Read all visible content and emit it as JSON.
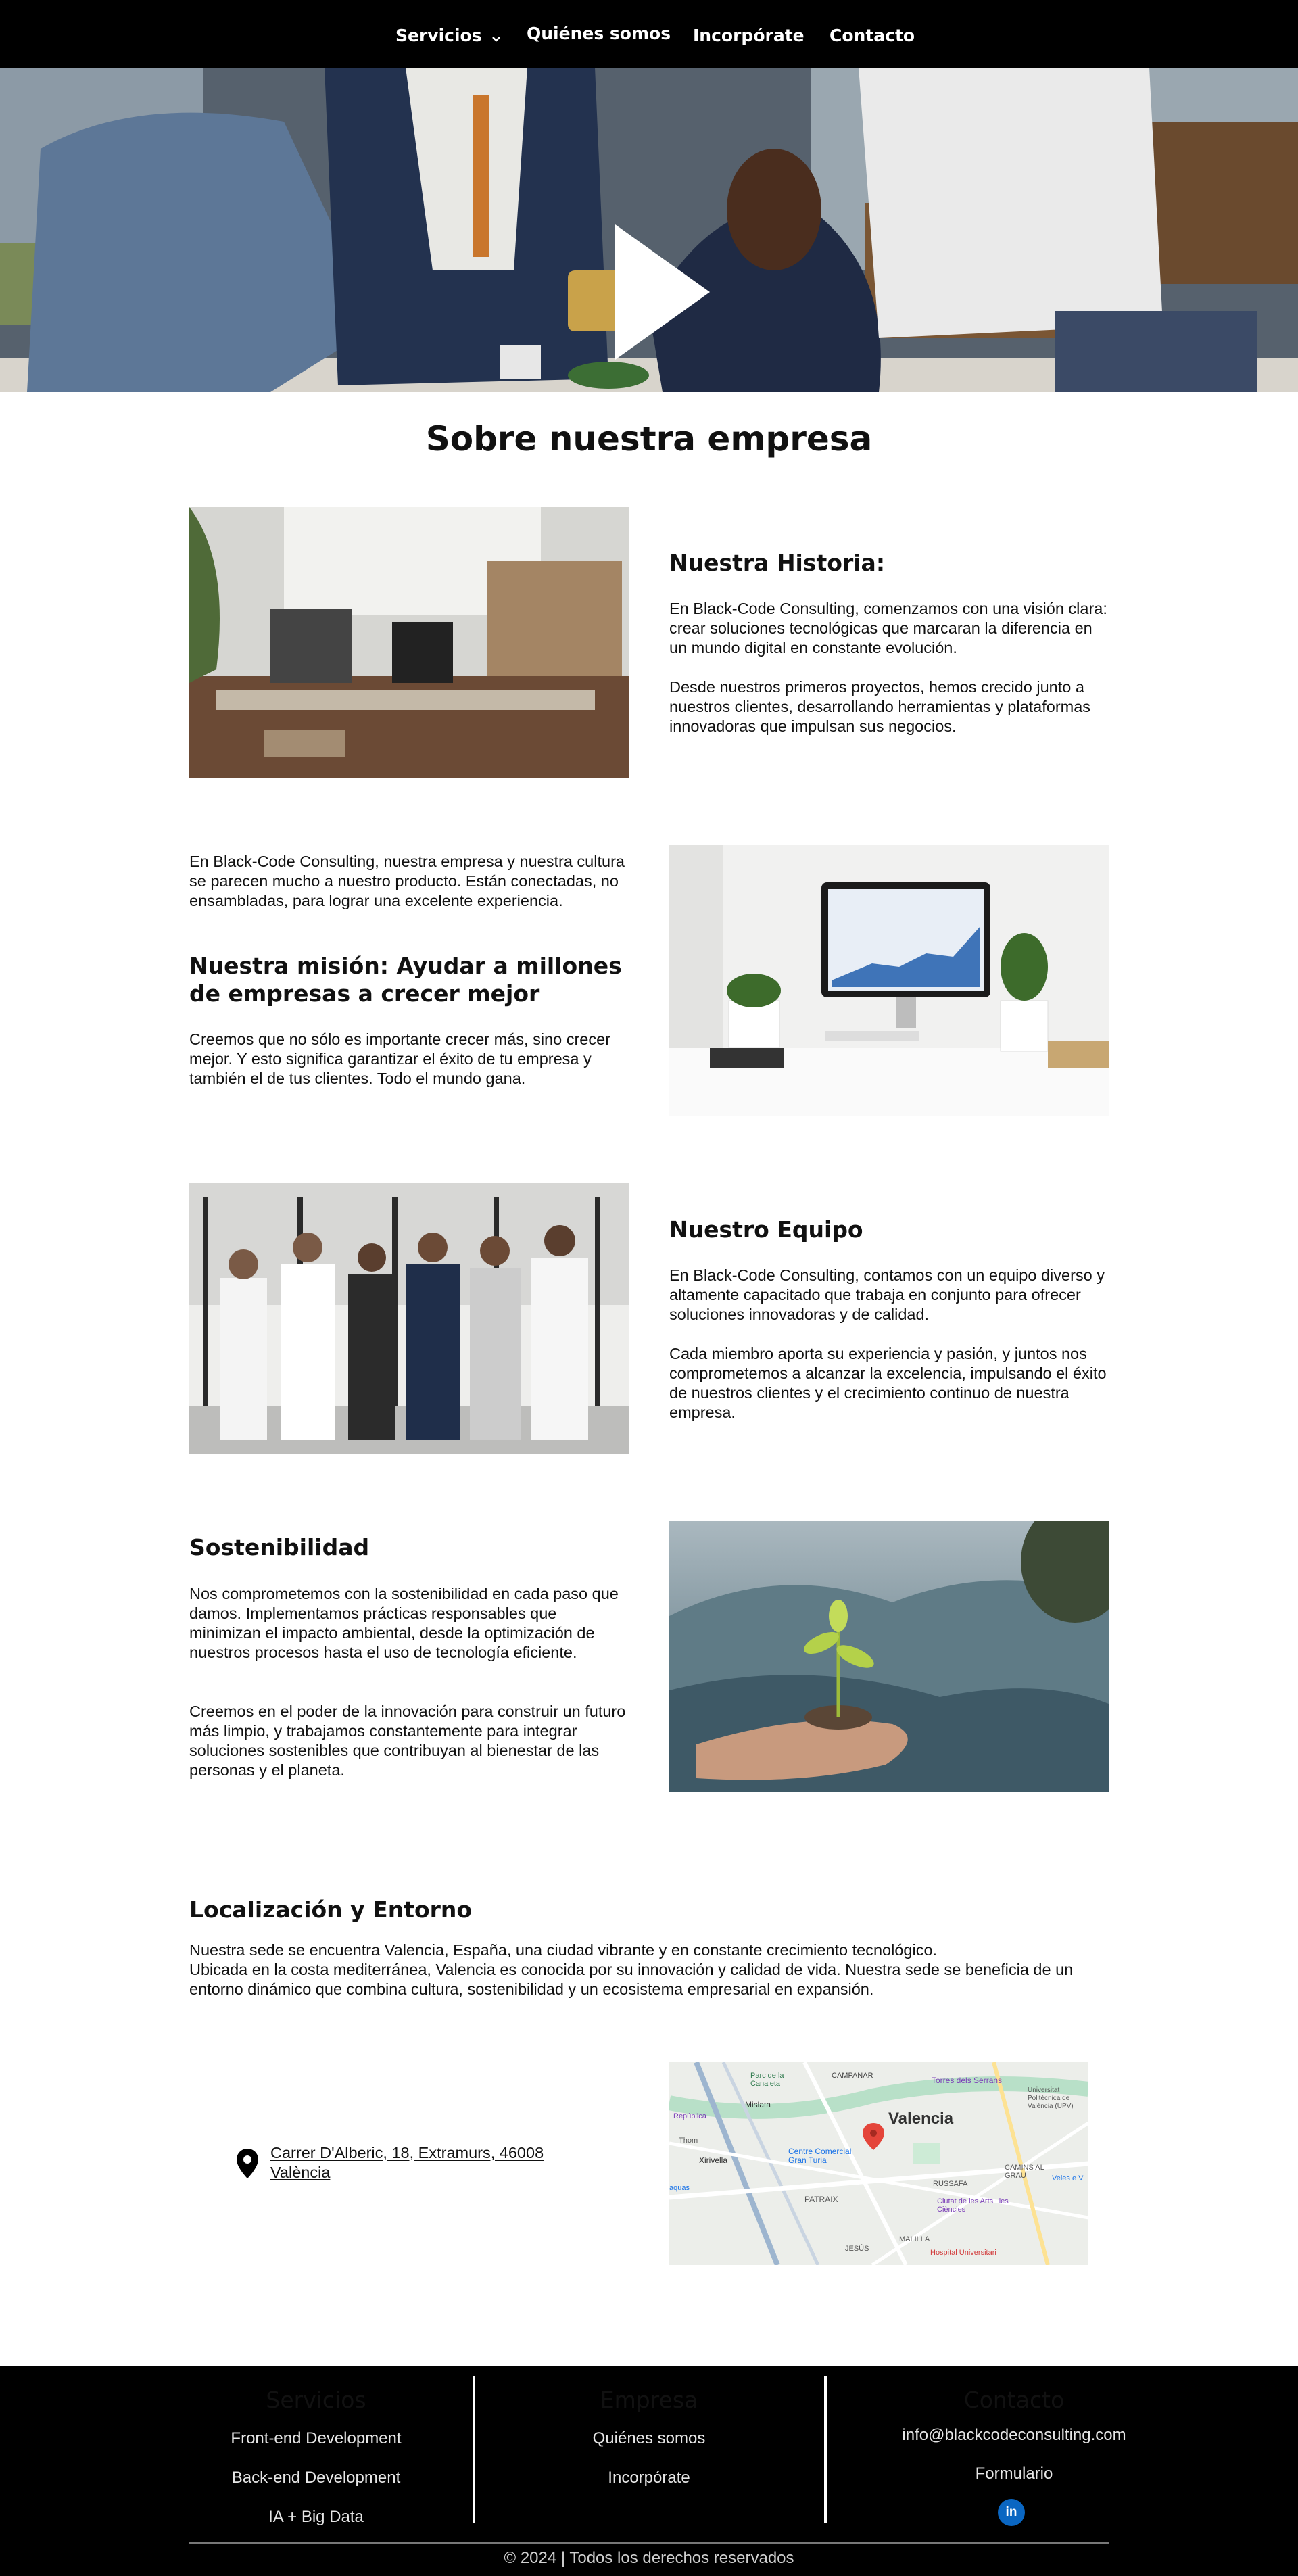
{
  "nav": {
    "items": [
      "Servicios",
      "Quiénes somos",
      "Incorpórate",
      "Contacto"
    ]
  },
  "hero": {
    "play_icon": "play-icon"
  },
  "page_title": "Sobre nuestra empresa",
  "history": {
    "title": "Nuestra Historia:",
    "p1": "En Black-Code Consulting, comenzamos con una visión clara: crear soluciones tecnológicas que marcaran la diferencia en un mundo digital en constante evolución.",
    "p2": "Desde nuestros primeros proyectos, hemos crecido junto a nuestros clientes, desarrollando herramientas y plataformas innovadoras que impulsan sus negocios."
  },
  "mission": {
    "intro": "En Black-Code Consulting, nuestra empresa y nuestra cultura se parecen mucho a nuestro producto. Están conectadas, no ensambladas, para lograr una excelente experiencia.",
    "title": "Nuestra misión: Ayudar a millones de empresas a crecer mejor",
    "p": "Creemos que no sólo es importante crecer más, sino crecer mejor. Y esto significa garantizar el éxito de tu empresa y también el de tus clientes. Todo el mundo gana."
  },
  "team": {
    "title": "Nuestro Equipo",
    "p1": "En Black-Code Consulting, contamos con un equipo diverso y altamente capacitado que trabaja en conjunto para ofrecer soluciones innovadoras y de calidad.",
    "p2": "Cada miembro aporta su experiencia y pasión, y juntos nos comprometemos a alcanzar la excelencia, impulsando el éxito de nuestros clientes y el crecimiento continuo de nuestra empresa."
  },
  "sustainability": {
    "title": "Sostenibilidad",
    "p1": "Nos comprometemos con la sostenibilidad en cada paso que damos. Implementamos prácticas responsables que minimizan el impacto ambiental, desde la optimización de nuestros procesos hasta el uso de tecnología eficiente.",
    "p2": "Creemos en el poder de la innovación para construir un futuro más limpio, y trabajamos constantemente para integrar soluciones sostenibles que contribuyan al bienestar de las personas y el planeta."
  },
  "location": {
    "title": "Localización y Entorno",
    "line1": "Nuestra sede  se encuentra Valencia, España, una ciudad vibrante y en constante crecimiento tecnológico.",
    "line2": "Ubicada en la costa mediterránea, Valencia es conocida por su innovación y calidad de vida. Nuestra sede se beneficia de un entorno dinámico que combina cultura, sostenibilidad y un ecosistema empresarial en expansión.",
    "address_line1": "Carrer D'Alberic, 18, Extramurs, 46008",
    "address_line2": "València",
    "map": {
      "city": "Valencia",
      "labels": [
        "Parc de la Canaleta",
        "Mislata",
        "Torres dels Serrans",
        "CAMPANAR",
        "Universitat Politècnica de València (UPV)",
        "Centre Comercial Gran Turia",
        "Xirivella",
        "PATRAIX",
        "RUSSAFA",
        "CAMINS AL GRAU",
        "Ciutat de les Arts i les Ciències",
        "MALILLA",
        "JESÚS",
        "Hospital Universitari",
        "República",
        "Thom",
        "aquas",
        "Veles e V"
      ]
    }
  },
  "footer": {
    "services": {
      "title": "Servicios",
      "links": [
        "Front-end Development",
        "Back-end Development",
        "IA + Big Data"
      ]
    },
    "company": {
      "title": "Empresa",
      "links": [
        "Quiénes somos",
        "Incorpórate"
      ]
    },
    "contact": {
      "title": "Contacto",
      "email": "info@blackcodeconsulting.com",
      "form": "Formulario",
      "social": "in"
    },
    "copyright": "© 2024 | Todos los derechos reservados"
  }
}
